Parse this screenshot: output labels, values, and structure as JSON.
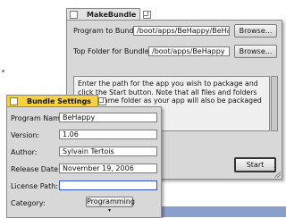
{
  "makebundle": {
    "title": "MakeBundle",
    "program_to_bundle_label": "Program to Bundle:",
    "program_to_bundle_value": "/boot/apps/BeHappy/BeHappy",
    "top_folder_label": "Top Folder for Bundle:",
    "top_folder_value": "/boot/apps/BeHappy",
    "browse_label": "Browse...",
    "help_text": "Enter the path for the app you wish to package and click the Start button. Note that all files and folders in the same folder as your app will also be packaged with your app.",
    "start_label": "Start"
  },
  "bundle_settings": {
    "title": "Bundle Settings",
    "program_name_label": "Program Name:",
    "program_name_value": "BeHappy",
    "version_label": "Version:",
    "version_value": "1.06",
    "author_label": "Author:",
    "author_value": "Sylvain Tertois",
    "release_date_label": "Release Date:",
    "release_date_value": "November 19, 2006",
    "license_path_label": "License Path:",
    "license_path_value": "",
    "category_label": "Category:",
    "category_value": "Programming",
    "category_arrow": "▾"
  },
  "colors": {
    "active_tab": "#f7d23e",
    "inactive_tab": "#e2e2e2",
    "window_bg": "#d8d8d8",
    "focus_border": "#2b55c9",
    "desktop_blue": "#8a9fc9"
  }
}
